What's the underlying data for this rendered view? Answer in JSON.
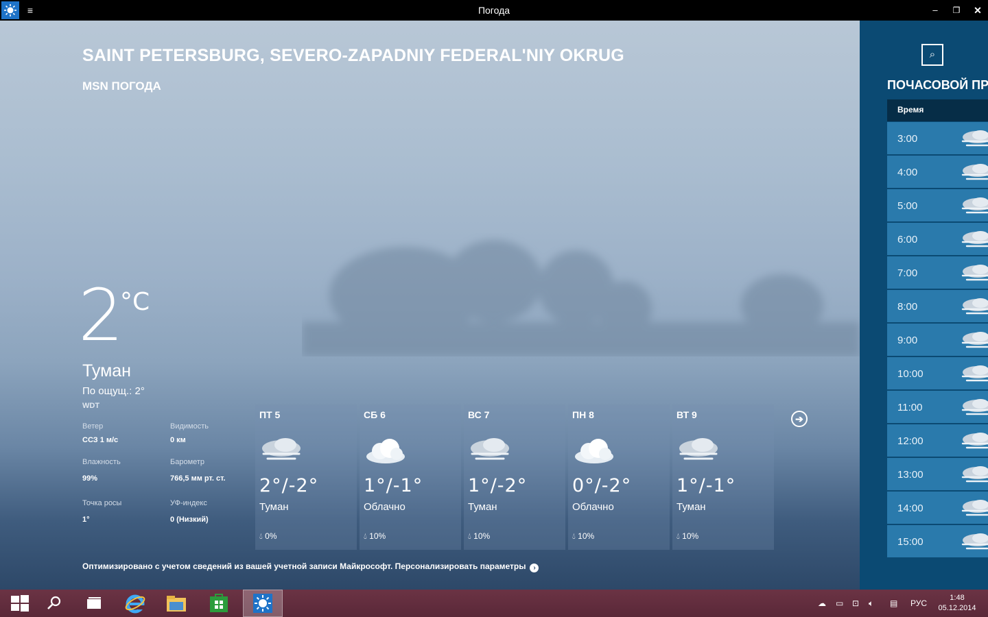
{
  "window": {
    "title": "Погода",
    "menu_glyph": "≡",
    "minimize": "–",
    "maximize": "❐",
    "close": "✕"
  },
  "location": {
    "city": "SAINT PETERSBURG, SEVERO-ZAPADNIY FEDERAL'NIY OKRUG",
    "provider": "MSN ПОГОДА"
  },
  "current": {
    "temp": "2",
    "unit": "°C",
    "condition": "Туман",
    "feels_like": "По ощущ.: 2°",
    "station": "WDT",
    "details": [
      {
        "label": "Ветер",
        "value": "ССЗ 1 м/с"
      },
      {
        "label": "Видимость",
        "value": "0 км"
      },
      {
        "label": "Влажность",
        "value": "99%"
      },
      {
        "label": "Барометр",
        "value": "766,5 мм рт. ст."
      },
      {
        "label": "Точка росы",
        "value": "1°"
      },
      {
        "label": "УФ-индекс",
        "value": "0 (Низкий)"
      }
    ]
  },
  "daily": [
    {
      "day": "ПТ 5",
      "temps": "2°/-2°",
      "condition": "Туман",
      "precip": "0%",
      "icon": "fog-cloud-icon"
    },
    {
      "day": "СБ 6",
      "temps": "1°/-1°",
      "condition": "Облачно",
      "precip": "10%",
      "icon": "cloud-icon"
    },
    {
      "day": "ВС 7",
      "temps": "1°/-2°",
      "condition": "Туман",
      "precip": "10%",
      "icon": "fog-cloud-icon"
    },
    {
      "day": "ПН 8",
      "temps": "0°/-2°",
      "condition": "Облачно",
      "precip": "10%",
      "icon": "cloud-icon"
    },
    {
      "day": "ВТ 9",
      "temps": "1°/-1°",
      "condition": "Туман",
      "precip": "10%",
      "icon": "fog-cloud-icon"
    }
  ],
  "next_arrow": "➔",
  "footer": {
    "note": "Оптимизировано с учетом сведений из вашей учетной записи Майкрософт. Персонализировать параметры",
    "arrow": "›"
  },
  "hourly": {
    "title": "ПОЧАСОВОЙ ПР",
    "header": "Время",
    "search_glyph": "⌕",
    "rows": [
      "3:00",
      "4:00",
      "5:00",
      "6:00",
      "7:00",
      "8:00",
      "9:00",
      "10:00",
      "11:00",
      "12:00",
      "13:00",
      "14:00",
      "15:00"
    ]
  },
  "taskbar": {
    "items": [
      "start-icon",
      "search-icon",
      "task-view-icon",
      "internet-explorer-icon",
      "file-explorer-icon",
      "store-icon",
      "weather-app-icon"
    ],
    "language": "РУС",
    "time": "1:48",
    "date": "05.12.2014"
  },
  "colors": {
    "pane": "#0b4a73",
    "row": "#2a7aac",
    "taskbar": "#5a2838"
  }
}
